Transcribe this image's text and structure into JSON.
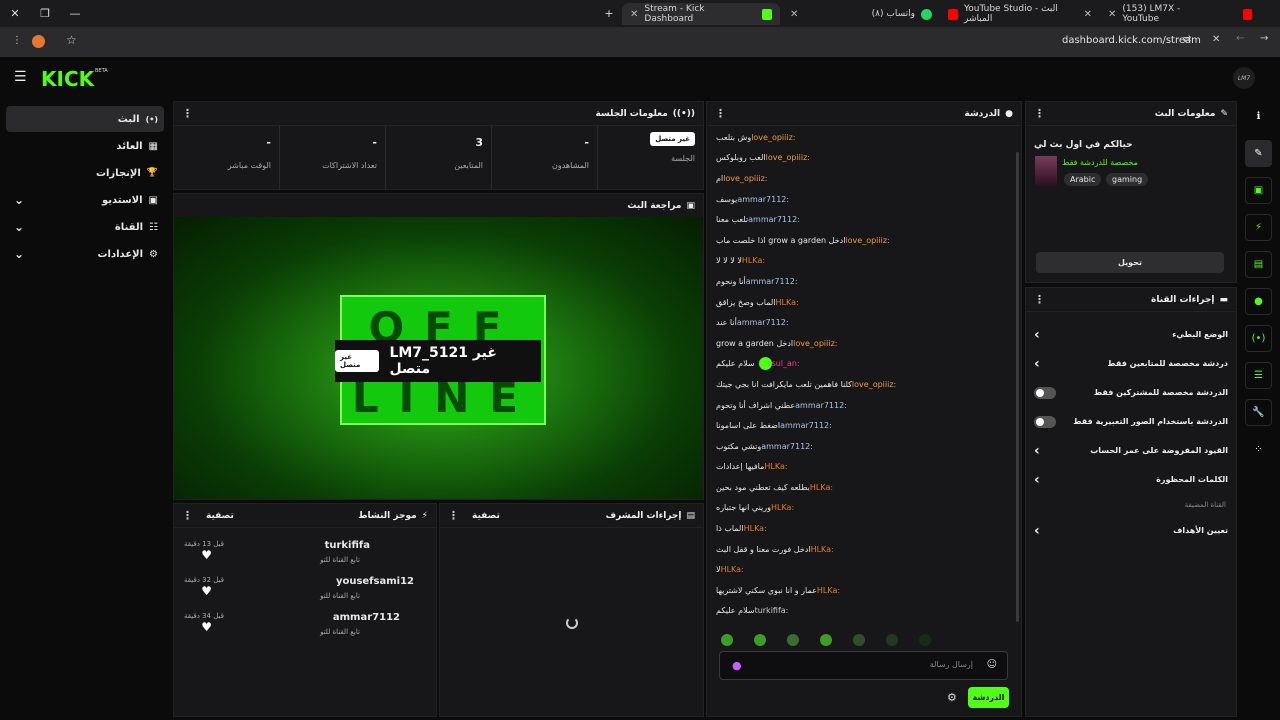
{
  "browser": {
    "tabs": [
      {
        "title": "Stream - Kick Dashboard",
        "favicon": "#53fc18"
      },
      {
        "title": "(٨) واتساب",
        "favicon": "#25d366"
      },
      {
        "title": "YouTube Studio - البث المباشر",
        "favicon": "#ff0000"
      },
      {
        "title": "(153) LM7X - YouTube",
        "favicon": "#ff0000"
      }
    ],
    "url": "dashboard.kick.com/stream"
  },
  "app": {
    "logo": "KICK",
    "beta": "BETA",
    "avatar": "LM7"
  },
  "sidebar": {
    "items": [
      {
        "label": "البث",
        "icon": "(•)",
        "expand": ""
      },
      {
        "label": "العائد",
        "icon": "▦",
        "expand": ""
      },
      {
        "label": "الإنجازات",
        "icon": "🏆",
        "expand": ""
      },
      {
        "label": "الاستديو",
        "icon": "▣",
        "expand": "⌄"
      },
      {
        "label": "القناة",
        "icon": "☷",
        "expand": "⌄"
      },
      {
        "label": "الإعدادات",
        "icon": "⚙",
        "expand": "⌄"
      }
    ]
  },
  "session": {
    "title": "معلومات الجلسة",
    "stats": [
      {
        "value": "-",
        "label": "الوقت مباشر"
      },
      {
        "value": "-",
        "label": "تعداد الاشتراكات"
      },
      {
        "value": "3",
        "label": "المتابعين"
      },
      {
        "value": "-",
        "label": "المشاهدون"
      },
      {
        "value": "غير متصل",
        "label": "الجلسة"
      }
    ]
  },
  "preview": {
    "title": "مراجعة البث",
    "off_top": "OFF",
    "off_bottom": "LINE",
    "status": "غير متصل",
    "channel": "LM7_5121 غير متصل"
  },
  "activity": {
    "title": "موجز النشاط",
    "filter": "تصفية",
    "items": [
      {
        "user": "turkififa",
        "sub": "تابع القناة للتو",
        "time": "قبل 13 دقيقة"
      },
      {
        "user": "yousefsami12",
        "sub": "تابع القناة للتو",
        "time": "قبل 32 دقيقة"
      },
      {
        "user": "ammar7112",
        "sub": "تابع القناة للتو",
        "time": "قبل 34 دقيقة"
      }
    ]
  },
  "modactions": {
    "title": "إجراءات المشرف",
    "filter": "تصفية"
  },
  "chat": {
    "title": "الدردشة",
    "messages": [
      {
        "user": "love_opiiiz:",
        "text": "وش بتلعب",
        "color": "#f2994a"
      },
      {
        "user": "love_opiiiz:",
        "text": "العب روبلوكس",
        "color": "#f2994a"
      },
      {
        "user": "love_opiiiz:",
        "text": "ام",
        "color": "#f2994a"
      },
      {
        "user": "ammar7112:",
        "text": "يوسف",
        "color": "#a9c3e6"
      },
      {
        "user": "ammar7112:",
        "text": "تلعب معنا",
        "color": "#a9c3e6"
      },
      {
        "user": "love_opiiiz:",
        "text": "اذا خلصت ماب grow a garden ادخل",
        "color": "#f2994a"
      },
      {
        "user": "HLKa:",
        "text": "لا لا لا لا",
        "color": "#e67e22"
      },
      {
        "user": "ammar7112:",
        "text": "أنا ونحوم",
        "color": "#a9c3e6"
      },
      {
        "user": "HLKa:",
        "text": "الماب وصخ يزاقق",
        "color": "#e67e22"
      },
      {
        "user": "ammar7112:",
        "text": "أنا عند",
        "color": "#a9c3e6"
      },
      {
        "user": "love_opiiiz:",
        "text": "grow a garden ادخل",
        "color": "#f2994a"
      },
      {
        "user": "sul_an:",
        "text": "سلام عليكم",
        "color": "#e84393"
      },
      {
        "user": "love_opiiiz:",
        "text": "كلنا فاهمين تلعب مايكرافت انا بجي جيتك",
        "color": "#f2994a"
      },
      {
        "user": "ammar7112:",
        "text": "عطني اشراف أنا وتحوم",
        "color": "#a9c3e6"
      },
      {
        "user": "ammar7112:",
        "text": "اضغط على اسامونا",
        "color": "#a9c3e6"
      },
      {
        "user": "ammar7112:",
        "text": "وتشي مكتوب",
        "color": "#a9c3e6"
      },
      {
        "user": "HLKa:",
        "text": "مافيها إعدادات",
        "color": "#e67e22"
      },
      {
        "user": "HLKa:",
        "text": "بطلعه كيف تعطني مود بحين",
        "color": "#e67e22"
      },
      {
        "user": "HLKa:",
        "text": "وريني انها جتباره",
        "color": "#e67e22"
      },
      {
        "user": "HLKa:",
        "text": "الماب ذا",
        "color": "#e67e22"
      },
      {
        "user": "HLKa:",
        "text": "ادخل فورت معنا و قفل البث",
        "color": "#e67e22"
      },
      {
        "user": "HLKa:",
        "text": "لا",
        "color": "#e67e22"
      },
      {
        "user": "HLKa:",
        "text": "عمار و انا نبوي سكني لاشتريها",
        "color": "#e67e22"
      },
      {
        "user": "turkififa:",
        "text": "سلام عليكم",
        "color": "#cfcfcf"
      }
    ],
    "placeholder": "إرسال رسالة",
    "send": "الدردشة"
  },
  "streaminfo": {
    "title": "معلومات البث",
    "stream_title": "حيالكم في اول بث لي",
    "category": "مخصصة للدردشة فقط",
    "tags": [
      "Arabic",
      "gaming"
    ],
    "edit": "تحويل"
  },
  "channelactions": {
    "title": "إجراءات القناة",
    "rows": [
      {
        "label": "الوضع البطيء",
        "control": "›"
      },
      {
        "label": "دردشة مخصصة للمتابعين فقط",
        "control": "›"
      },
      {
        "label": "الدردشة مخصصة للمشتركين فقط",
        "control": "toggle"
      },
      {
        "label": "الدردشة باستخدام الصور التعبيرية فقط",
        "control": "toggle"
      },
      {
        "label": "القيود المفروضة على عمر الحساب",
        "control": "›"
      },
      {
        "label": "الكلمات المحظورة",
        "control": "›"
      }
    ],
    "section": "القناة المضيفة",
    "host_row": "تعيين الأهداف"
  },
  "colors": {
    "accent": "#53fc18",
    "panel": "#171719"
  }
}
